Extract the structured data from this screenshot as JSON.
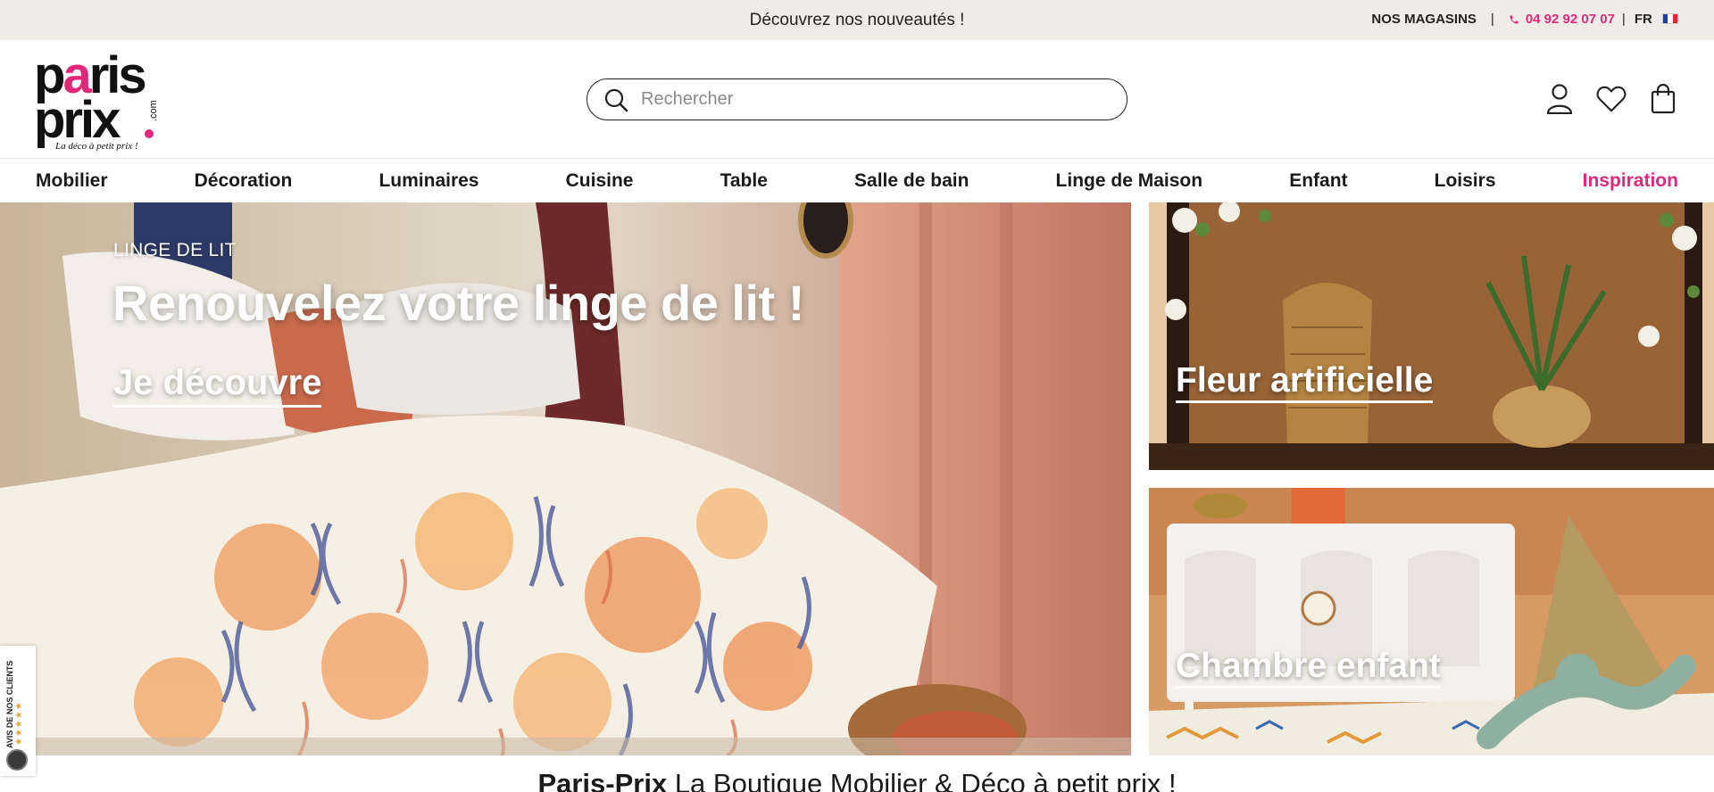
{
  "topbar": {
    "announcement": "Découvrez nos nouveautés !",
    "stores_label": "NOS MAGASINS",
    "separator": "|",
    "phone": "04 92 92 07 07",
    "language": "FR"
  },
  "header": {
    "logo": {
      "line1": "paris",
      "line2": "prix",
      "dotcom": ".com",
      "slogan": "La déco à petit prix !"
    },
    "search": {
      "placeholder": "Rechercher",
      "value": ""
    },
    "icons": [
      "user-icon",
      "heart-icon",
      "bag-icon"
    ]
  },
  "nav": {
    "items": [
      {
        "label": "Mobilier"
      },
      {
        "label": "Décoration"
      },
      {
        "label": "Luminaires"
      },
      {
        "label": "Cuisine"
      },
      {
        "label": "Table"
      },
      {
        "label": "Salle de bain"
      },
      {
        "label": "Linge de Maison"
      },
      {
        "label": "Enfant"
      },
      {
        "label": "Loisirs"
      },
      {
        "label": "Inspiration"
      }
    ]
  },
  "hero": {
    "eyebrow": "LINGE DE LIT",
    "title": "Renouvelez votre linge de lit !",
    "cta": "Je découvre",
    "side1_label": "Fleur artificielle",
    "side2_label": "Chambre enfant"
  },
  "reviews_widget": {
    "label": "AVIS DE NOS CLIENTS",
    "stars": "★★★★★"
  },
  "tagline": {
    "brand": "Paris-Prix",
    "text": " La Boutique Mobilier & Déco à petit prix !"
  },
  "colors": {
    "accent": "#e3277a",
    "topbar_bg": "#efece8",
    "text": "#1a1a1a"
  }
}
